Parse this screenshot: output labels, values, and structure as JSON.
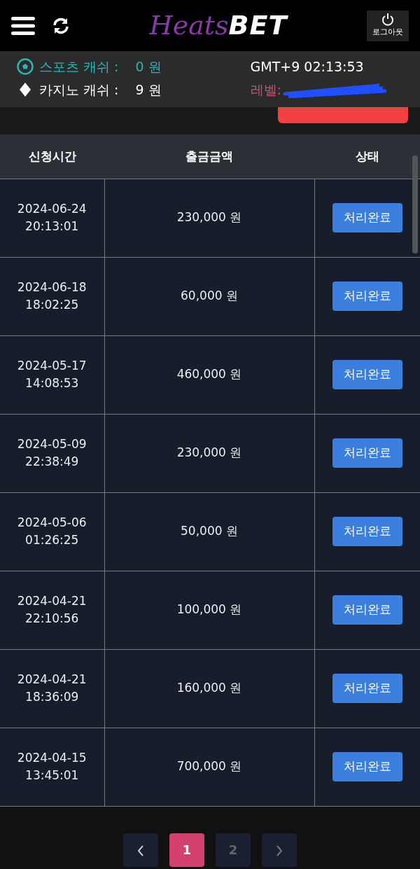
{
  "header": {
    "logo": {
      "script_part": "Heats",
      "bold_part": "BET"
    },
    "logout_label": "로그아웃"
  },
  "balances": [
    {
      "kind": "sports",
      "label": "스포츠 캐쉬 :",
      "amount": "0 원"
    },
    {
      "kind": "casino",
      "label": "카지노 캐쉬 :",
      "amount": "9 원"
    }
  ],
  "clock": "GMT+9 02:13:53",
  "level_label": "레벨:",
  "table": {
    "columns": [
      "신청시간",
      "출금금액",
      "상태"
    ],
    "rows": [
      {
        "date": "2024-06-24",
        "time": "20:13:01",
        "amount": "230,000 원",
        "status": "처리완료"
      },
      {
        "date": "2024-06-18",
        "time": "18:02:25",
        "amount": "60,000 원",
        "status": "처리완료"
      },
      {
        "date": "2024-05-17",
        "time": "14:08:53",
        "amount": "460,000 원",
        "status": "처리완료"
      },
      {
        "date": "2024-05-09",
        "time": "22:38:49",
        "amount": "230,000 원",
        "status": "처리완료"
      },
      {
        "date": "2024-05-06",
        "time": "01:26:25",
        "amount": "50,000 원",
        "status": "처리완료"
      },
      {
        "date": "2024-04-21",
        "time": "22:10:56",
        "amount": "100,000 원",
        "status": "처리완료"
      },
      {
        "date": "2024-04-21",
        "time": "18:36:09",
        "amount": "160,000 원",
        "status": "처리완료"
      },
      {
        "date": "2024-04-15",
        "time": "13:45:01",
        "amount": "700,000 원",
        "status": "처리완료"
      }
    ]
  },
  "pagination": {
    "pages": [
      {
        "label": "1",
        "selected": true
      },
      {
        "label": "2",
        "selected": false
      }
    ]
  }
}
